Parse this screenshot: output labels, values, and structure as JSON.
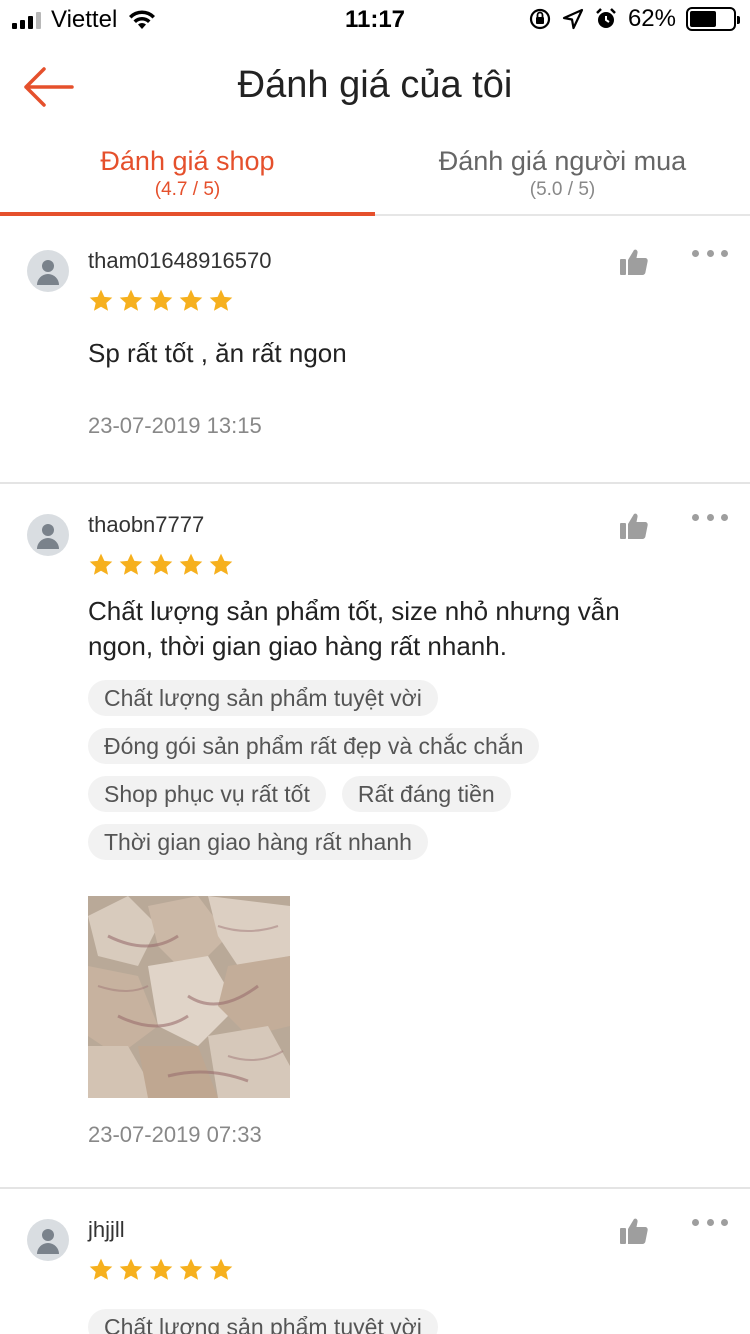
{
  "status_bar": {
    "carrier": "Viettel",
    "time": "11:17",
    "battery_percent": "62%",
    "battery_level": 0.62,
    "icons": [
      "signal-icon",
      "wifi-icon",
      "orientation-lock-icon",
      "location-icon",
      "alarm-icon",
      "battery-icon"
    ]
  },
  "header": {
    "title": "Đánh giá của tôi",
    "back_icon": "arrow-left-icon"
  },
  "tabs": [
    {
      "label": "Đánh giá shop",
      "score": "(4.7 / 5)",
      "active": true
    },
    {
      "label": "Đánh giá người mua",
      "score": "(5.0 / 5)",
      "active": false
    }
  ],
  "colors": {
    "accent": "#e5502c",
    "star": "#f6b01e",
    "divider": "#e4e4e4",
    "tag_bg": "#f2f2f2"
  },
  "reviews": [
    {
      "username": "tham01648916570",
      "rating": 5,
      "max_rating": 5,
      "comment": "Sp rất tốt , ăn rất ngon",
      "tags": [],
      "date": "23-07-2019 13:15"
    },
    {
      "username": "thaobn7777",
      "rating": 5,
      "max_rating": 5,
      "comment": "Chất lượng sản phẩm tốt, size nhỏ nhưng vẫn ngon, thời gian giao hàng rất nhanh.",
      "tags": [
        "Chất lượng sản phẩm tuyệt vời",
        "Đóng gói sản phẩm rất đẹp và chắc chắn",
        "Shop phục vụ rất tốt",
        "Rất đáng tiền",
        "Thời gian giao hàng rất nhanh"
      ],
      "has_photo": true,
      "date": "23-07-2019 07:33"
    },
    {
      "username": "jhjjll",
      "rating": 5,
      "max_rating": 5,
      "comment": "",
      "tags": [
        "Chất lượng sản phẩm tuyệt vời"
      ],
      "date": ""
    }
  ]
}
